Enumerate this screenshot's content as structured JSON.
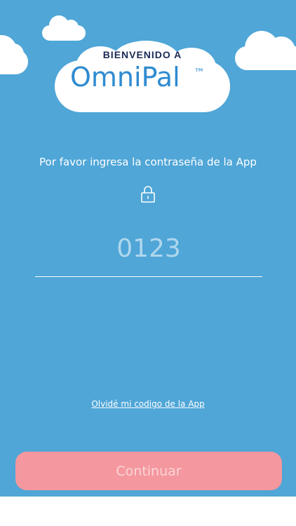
{
  "header": {
    "welcome": "BIENVENIDO A",
    "brand": "OmniPal",
    "trademark": "™"
  },
  "form": {
    "prompt": "Por favor ingresa la contraseña de la App",
    "pin_placeholder": "0123",
    "pin_value": "",
    "forgot_link": "Olvidé mi codigo de la App",
    "continue_label": "Continuar"
  },
  "colors": {
    "background": "#4fa6d7",
    "brand_blue": "#2f8bd0",
    "button": "#f4979e"
  },
  "icons": {
    "lock": "lock-icon"
  }
}
